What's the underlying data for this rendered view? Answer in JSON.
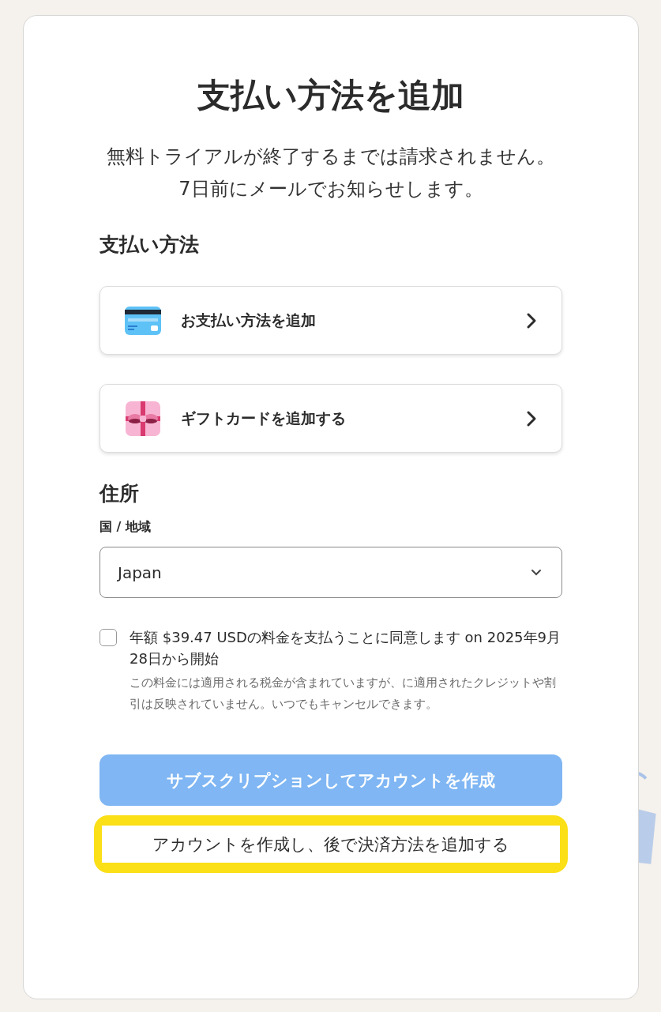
{
  "title": "支払い方法を追加",
  "subtitle": "無料トライアルが終了するまでは請求されません。7日前にメールでお知らせします。",
  "payment": {
    "heading": "支払い方法",
    "options": [
      {
        "kind": "card",
        "label": "お支払い方法を追加"
      },
      {
        "kind": "gift",
        "label": "ギフトカードを追加する"
      }
    ]
  },
  "address": {
    "heading": "住所",
    "field_label": "国 / 地域",
    "value": "Japan"
  },
  "consent": {
    "checked": false,
    "label": "年額 $39.47 USDの料金を支払うことに同意します on 2025年9月28日から開始",
    "note": "この料金には適用される税金が含まれていますが、に適用されたクレジットや割引は反映されていません。いつでもキャンセルできます。"
  },
  "subscribe_button": {
    "label": "サブスクリプションしてアカウントを作成",
    "disabled": true
  },
  "later_button": {
    "label": "アカウントを作成し、後で決済方法を追加する",
    "highlighted": true
  }
}
